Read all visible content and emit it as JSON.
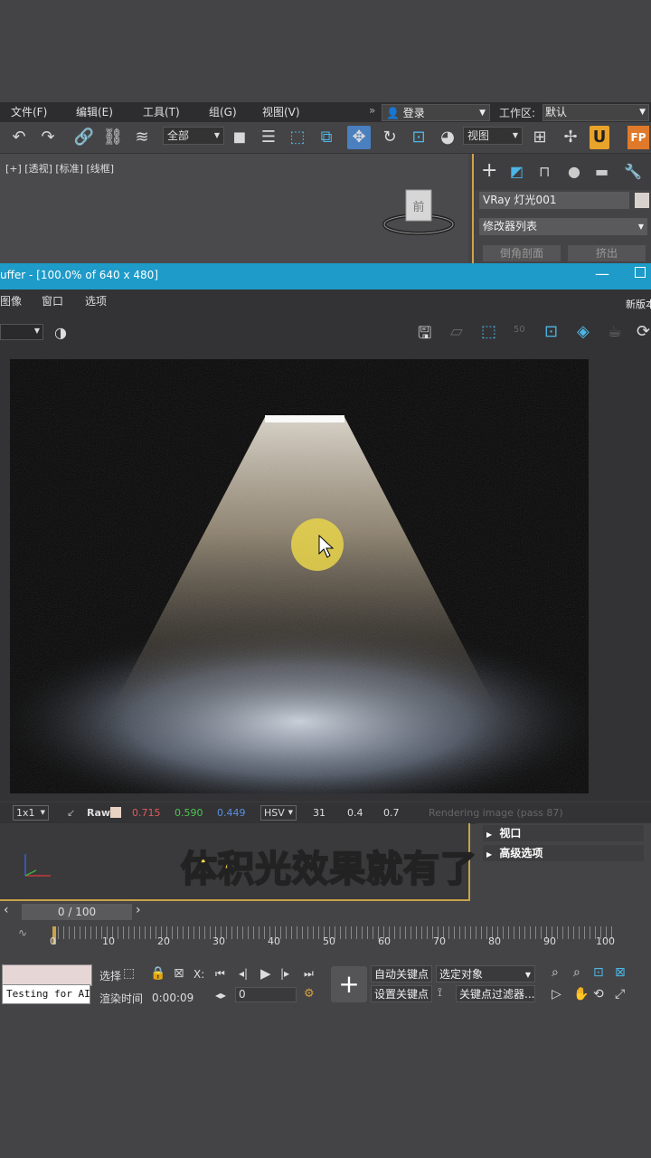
{
  "menubar": {
    "items": [
      "文件(F)",
      "编辑(E)",
      "工具(T)",
      "组(G)",
      "视图(V)"
    ],
    "login": "登录",
    "workspace_label": "工作区:",
    "workspace_value": "默认"
  },
  "toolbar": {
    "filter_select": "全部",
    "view_select": "视图"
  },
  "viewport": {
    "label": "[+] [透视] [标准] [线框]",
    "viewcube_text": "前"
  },
  "command_panel": {
    "object_name": "VRay 灯光001",
    "modifier_list": "修改器列表",
    "partial_button_1": "倒角剖面",
    "partial_button_2": "挤出"
  },
  "frame_buffer": {
    "title": "uffer - [100.0% of 640 x 480]",
    "menu": [
      "图像",
      "窗口",
      "选项"
    ],
    "right_label": "新版本",
    "zoom_badge": "50"
  },
  "status": {
    "sample": "1x1",
    "raw": "Raw",
    "r": "0.715",
    "g": "0.590",
    "b": "0.449",
    "mode": "HSV",
    "h": "31",
    "s": "0.4",
    "v": "0.7",
    "message": "Rendering image (pass 87)",
    "colors": {
      "r": "#e05a5a",
      "g": "#4fc34f",
      "b": "#5a8fe0"
    }
  },
  "rollouts": [
    "视口",
    "高级选项"
  ],
  "subtitle": "体积光效果就有了",
  "timeline": {
    "slider": "0 / 100",
    "ticks": [
      "0",
      "10",
      "20",
      "30",
      "40",
      "50",
      "60",
      "70",
      "80",
      "90",
      "100"
    ]
  },
  "bottom": {
    "script_text": "Testing for AI/",
    "select_label": "选择",
    "x_label": "X:",
    "render_time_label": "渲染时间",
    "render_time": "0:00:09",
    "frame_value": "0",
    "auto_key": "自动关键点",
    "set_key": "设置关键点",
    "selected_object": "选定对象",
    "key_filter": "关键点过滤器..."
  }
}
